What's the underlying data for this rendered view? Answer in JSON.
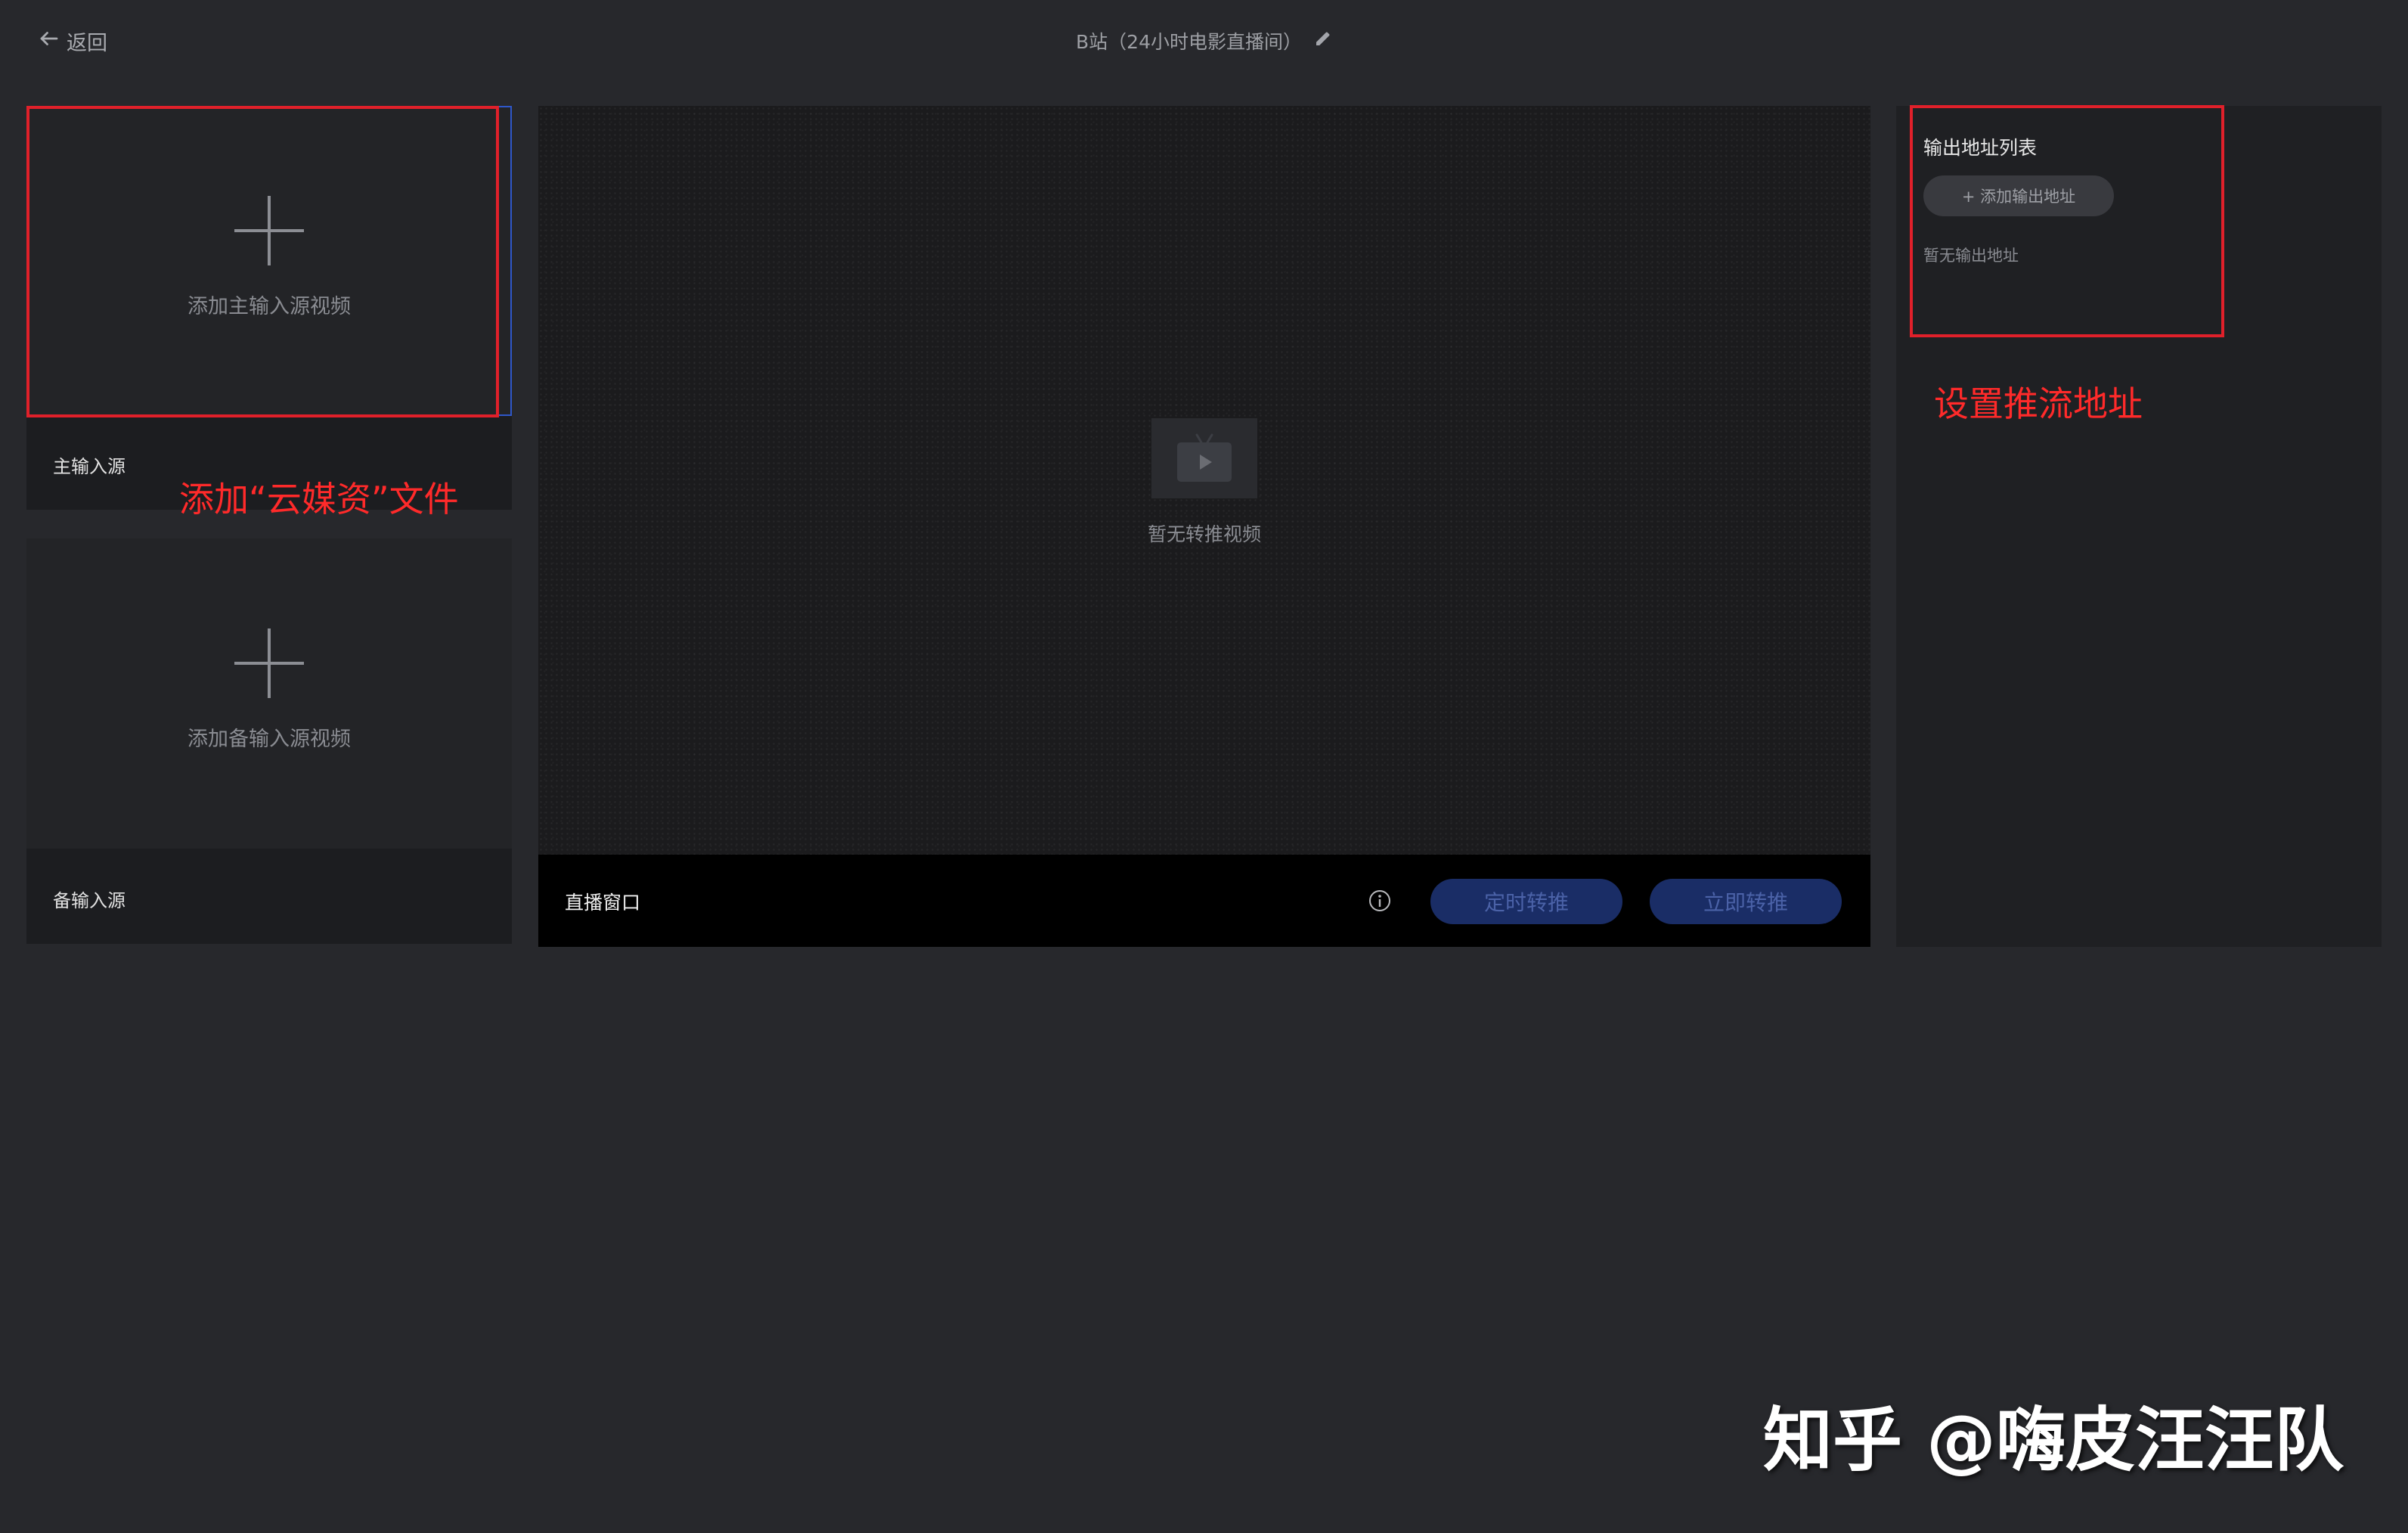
{
  "header": {
    "back_label": "返回",
    "title": "B站（24小时电影直播间）"
  },
  "left": {
    "main_source": {
      "add_label": "添加主输入源视频",
      "footer_label": "主输入源"
    },
    "backup_source": {
      "add_label": "添加备输入源视频",
      "footer_label": "备输入源"
    }
  },
  "preview": {
    "empty_text": "暂无转推视频",
    "bar_title": "直播窗口",
    "scheduled_button": "定时转推",
    "now_button": "立即转推"
  },
  "output": {
    "title": "输出地址列表",
    "add_button": "+ 添加输出地址",
    "empty_text": "暂无输出地址"
  },
  "annotations": {
    "left_note": "添加“云媒资”文件",
    "right_note": "设置推流地址"
  },
  "watermark": "知乎 @嗨皮汪汪队",
  "colors": {
    "background": "#27282c",
    "annotation_red": "#e0202a",
    "button_blue": "#1a2d66",
    "accent_blue": "#2f57c9"
  }
}
